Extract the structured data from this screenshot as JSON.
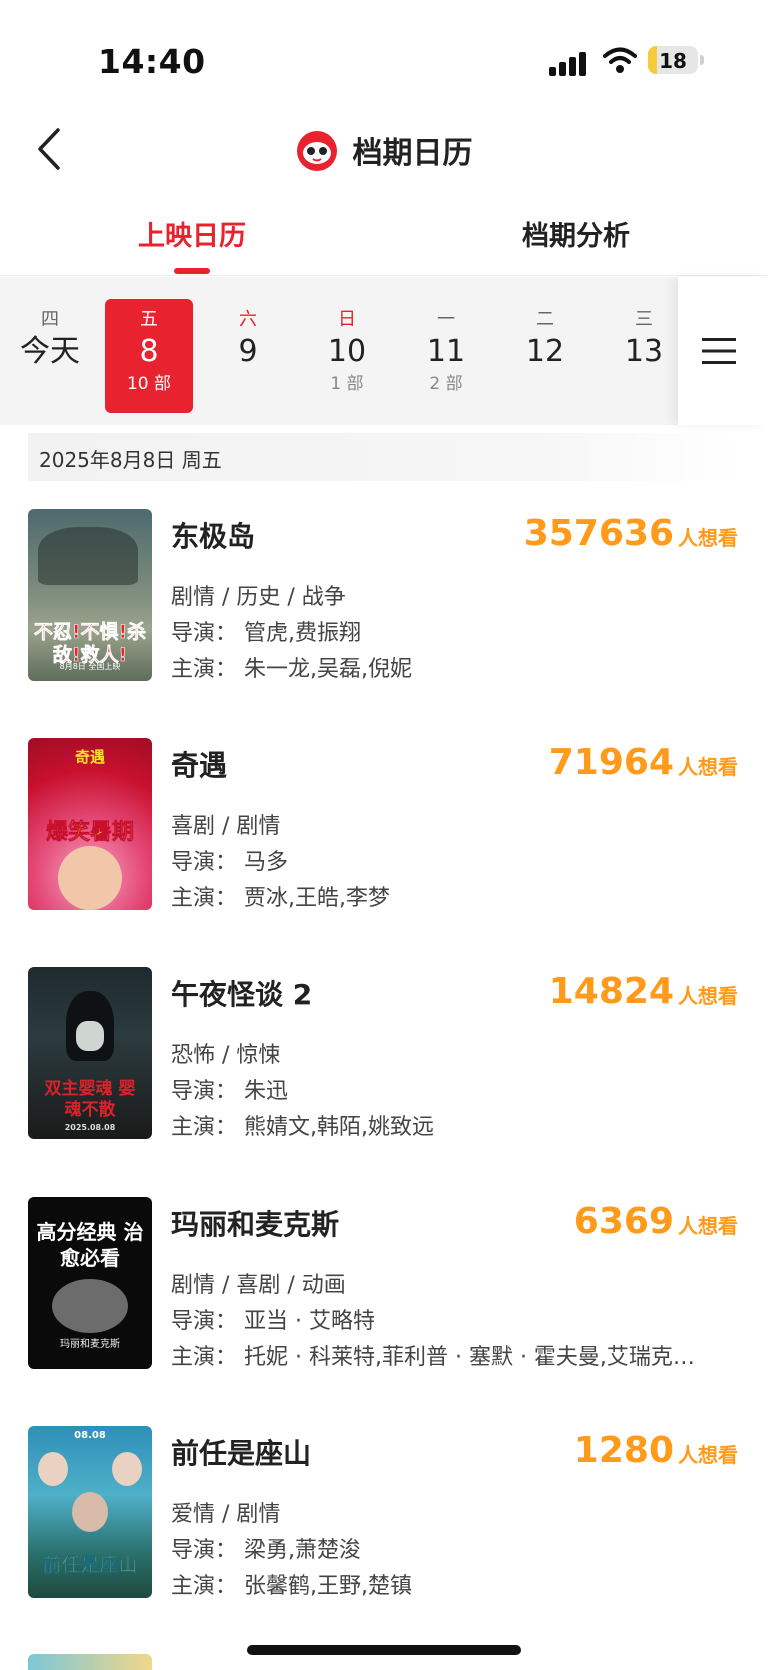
{
  "status_bar": {
    "time": "14:40",
    "battery_level": "18",
    "battery_fraction": 0.18
  },
  "header": {
    "title": "档期日历",
    "logo_icon": "maoyan-cat-logo-icon",
    "back_icon": "chevron-left-icon"
  },
  "tabs": [
    {
      "label": "上映日历",
      "active": true
    },
    {
      "label": "档期分析",
      "active": false
    }
  ],
  "date_strip": [
    {
      "weekday": "四",
      "day": "今天",
      "count": "",
      "weekend": false,
      "active": false
    },
    {
      "weekday": "五",
      "day": "8",
      "count": "10 部",
      "weekend": false,
      "active": true
    },
    {
      "weekday": "六",
      "day": "9",
      "count": "",
      "weekend": true,
      "active": false
    },
    {
      "weekday": "日",
      "day": "10",
      "count": "1 部",
      "weekend": true,
      "active": false
    },
    {
      "weekday": "一",
      "day": "11",
      "count": "2 部",
      "weekend": false,
      "active": false
    },
    {
      "weekday": "二",
      "day": "12",
      "count": "",
      "weekend": false,
      "active": false
    },
    {
      "weekday": "三",
      "day": "13",
      "count": "",
      "weekend": false,
      "active": false
    }
  ],
  "menu_icon": "hamburger-menu-icon",
  "date_banner": "2025年8月8日  周五",
  "want_label": "人想看",
  "movies": [
    {
      "title": "东极岛",
      "want": "357636",
      "genre": "剧情 / 历史 / 战争",
      "director": "导演：  管虎,费振翔",
      "cast": "主演：  朱一龙,吴磊,倪妮",
      "poster_text": "不忍!不惧!杀敌!救人!",
      "poster_sub": "8月8日 全国上映"
    },
    {
      "title": "奇遇",
      "want": "71964",
      "genre": "喜剧 / 剧情",
      "director": "导演：  马多",
      "cast": "主演：  贾冰,王皓,李梦",
      "poster_text": "爆笑暑期",
      "poster_sub": "奇遇"
    },
    {
      "title": "午夜怪谈 2",
      "want": "14824",
      "genre": "恐怖 / 惊悚",
      "director": "导演：  朱迅",
      "cast": "主演：  熊婧文,韩陌,姚致远",
      "poster_text": "双主婴魂 婴魂不散",
      "poster_sub": "2025.08.08"
    },
    {
      "title": "玛丽和麦克斯",
      "want": "6369",
      "genre": "剧情 / 喜剧 / 动画",
      "director": "导演：  亚当 · 艾略特",
      "cast": "主演：  托妮 · 科莱特,菲利普 · 塞默 · 霍夫曼,艾瑞克…",
      "poster_text": "高分经典 治愈必看",
      "poster_sub": "玛丽和麦克斯"
    },
    {
      "title": "前任是座山",
      "want": "1280",
      "genre": "爱情 / 剧情",
      "director": "导演：  梁勇,萧楚浚",
      "cast": "主演：  张馨鹤,王野,楚镇",
      "poster_text": "前任是座山",
      "poster_sub": "08.08"
    }
  ]
}
